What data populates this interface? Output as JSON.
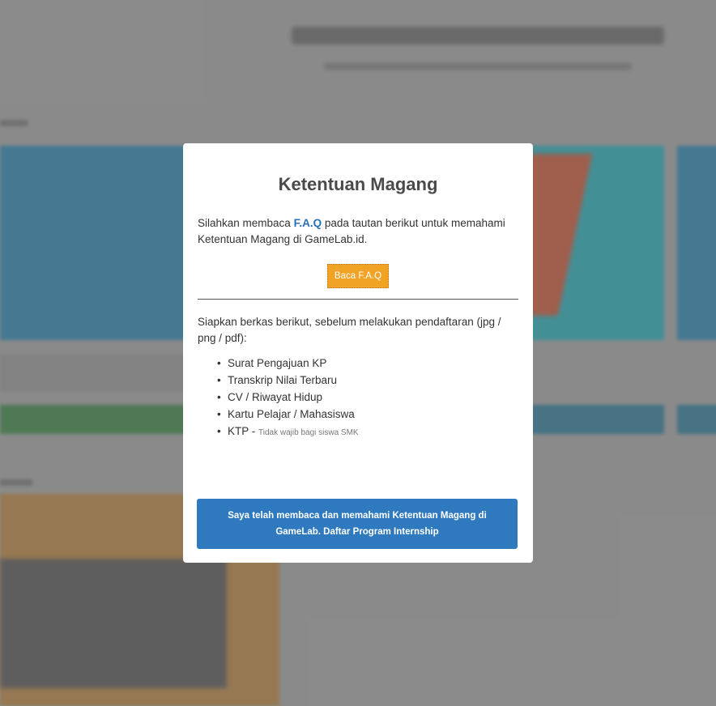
{
  "modal": {
    "title": "Ketentuan Magang",
    "intro_before": "Silahkan membaca ",
    "faq_link": "F.A.Q",
    "intro_after": " pada tautan berikut untuk memahami Ketentuan Magang di GameLab.id.",
    "faq_button": "Baca F.A.Q",
    "prep_text": "Siapkan berkas berikut, sebelum melakukan pendaftaran (jpg / png / pdf):",
    "requirements": [
      {
        "label": "Surat Pengajuan KP",
        "note": ""
      },
      {
        "label": "Transkrip Nilai Terbaru",
        "note": ""
      },
      {
        "label": "CV / Riwayat Hidup",
        "note": ""
      },
      {
        "label": "Kartu Pelajar / Mahasiswa",
        "note": ""
      },
      {
        "label": "KTP - ",
        "note": "Tidak wajib bagi siswa SMK"
      }
    ],
    "bullet": "•",
    "submit_button": "Saya telah membaca dan memahami Ketentuan Magang di GameLab. Daftar Program Internship"
  },
  "colors": {
    "faq_button": "#f0a324",
    "submit_button": "#2f7abf",
    "link": "#2a6fb5"
  }
}
